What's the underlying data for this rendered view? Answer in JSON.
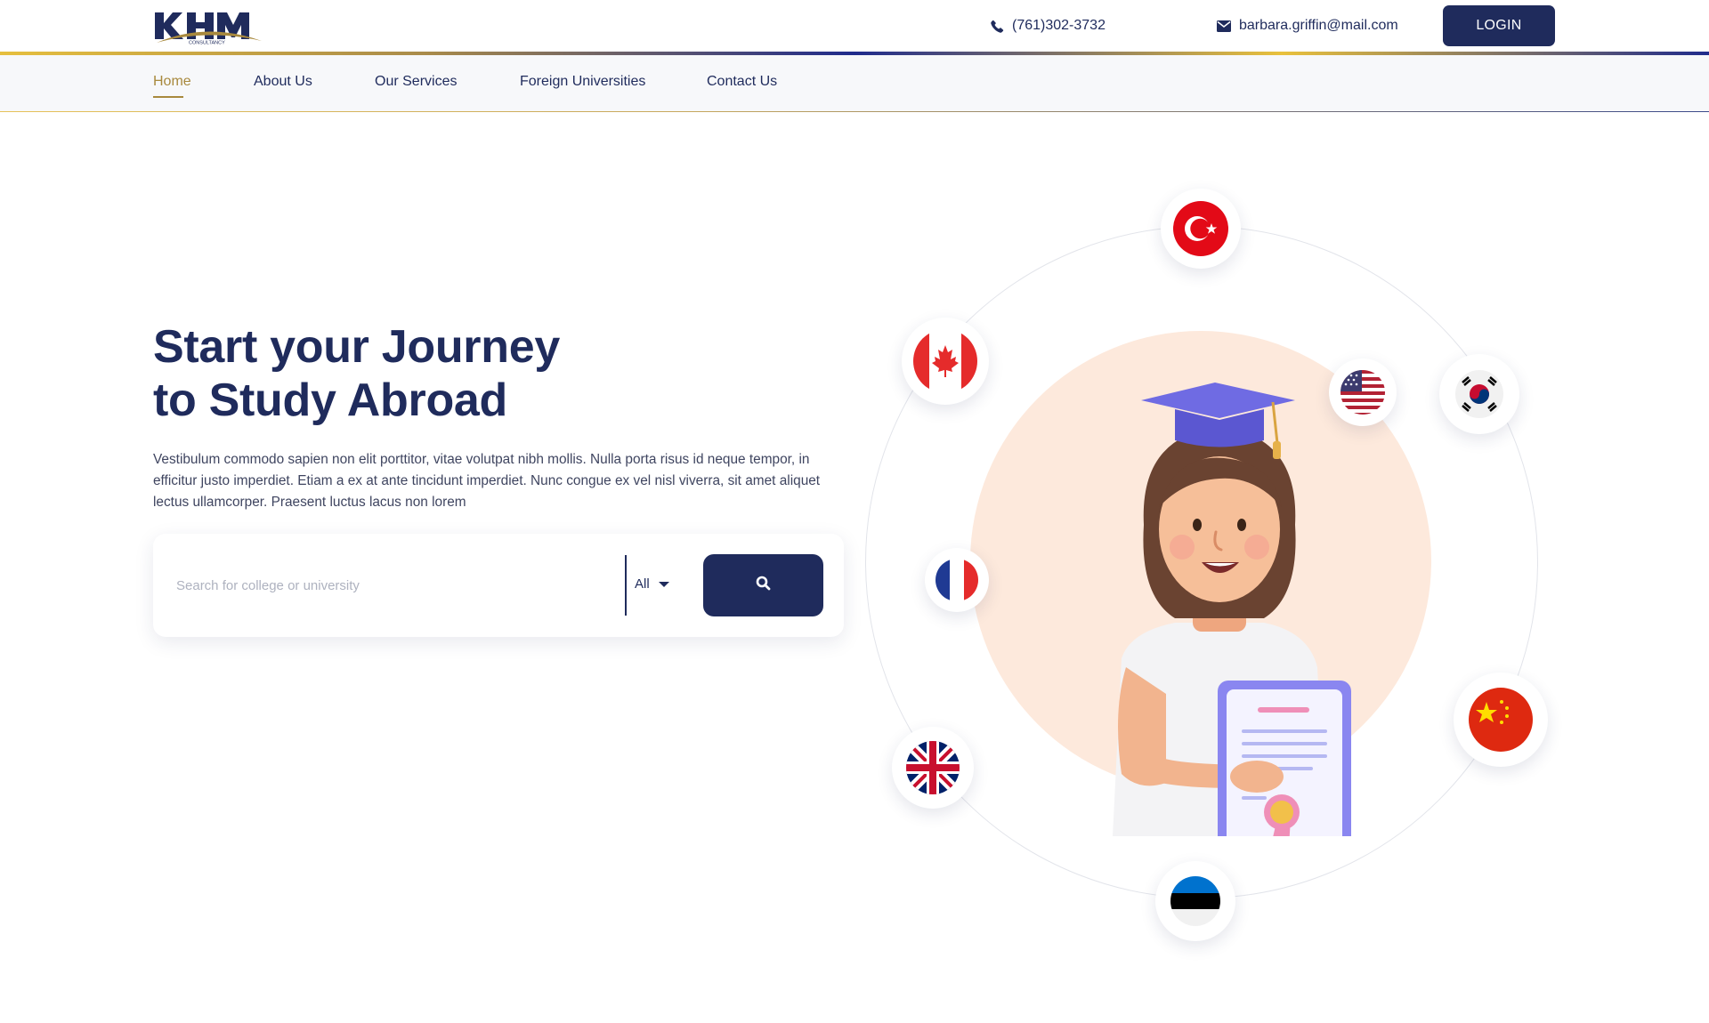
{
  "header": {
    "logo_alt": "KHM Consultancy",
    "logo_small_text": "CONSULTANCY",
    "phone": "(761)302-3732",
    "email": "barbara.griffin@mail.com",
    "login_label": "LOGIN"
  },
  "nav": {
    "items": [
      {
        "label": "Home",
        "active": true
      },
      {
        "label": "About Us",
        "active": false
      },
      {
        "label": "Our Services",
        "active": false
      },
      {
        "label": "Foreign Universities",
        "active": false
      },
      {
        "label": "Contact Us",
        "active": false
      }
    ]
  },
  "hero": {
    "title_line1": "Start your Journey",
    "title_line2": "to Study Abroad",
    "description": "Vestibulum commodo sapien non elit porttitor, vitae volutpat nibh mollis. Nulla porta risus id neque tempor, in efficitur justo imperdiet. Etiam a ex at ante tincidunt imperdiet. Nunc congue ex vel nisl viverra, sit amet aliquet lectus ullamcorper. Praesent luctus lacus non lorem"
  },
  "search": {
    "placeholder": "Search for college or university",
    "value": "",
    "filter_selected": "All"
  },
  "illustration": {
    "flags": [
      "turkey",
      "canada",
      "usa",
      "south-korea",
      "france",
      "china",
      "united-kingdom",
      "estonia"
    ]
  },
  "colors": {
    "primary": "#1f2b5c",
    "accent_gold": "#a8893d",
    "peach": "#fde9dc",
    "nav_bg": "#f7f8fa"
  },
  "icons": {
    "phone": "phone-icon",
    "email": "envelope-icon",
    "search": "search-icon",
    "filter": "caret-down-icon"
  }
}
